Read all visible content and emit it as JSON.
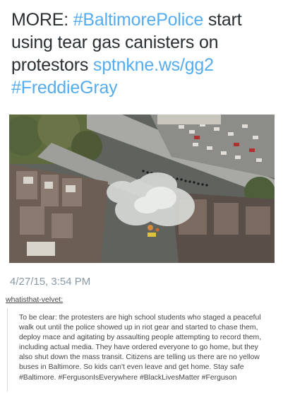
{
  "tweet": {
    "line1_prefix": "MORE: ",
    "line1_hashtag": "#BaltimorePolice",
    "line1_suffix": " start",
    "line2": "using tear gas canisters on",
    "line3_prefix": "protestors ",
    "line3_link": "sptnkne.ws/gg2",
    "line4_hashtag": "#FreddieGray",
    "timestamp": "4/27/15, 3:54 PM"
  },
  "reblog": {
    "username": "whatisthat-velvet:",
    "lines": [
      "To be clear: the protesters are high school students who staged a peaceful",
      "walk out until the police showed up in riot gear and started to chase them,",
      "deploy mace and agitating by assaulting people attempting to record them,",
      "including actual media. They have ordered everyone to go home, but they",
      "also shut down the mass transit. Citizens are telling us there are no yellow",
      "buses in Baltimore. So kids can't even leave and get home. Stay safe",
      "#Baltimore. #FergusonIsEverywhere #BlackLivesMatter #Ferguson"
    ]
  },
  "colors": {
    "accent": "#55acee",
    "text": "#292f33",
    "muted": "#8899a6",
    "body": "#444444"
  }
}
